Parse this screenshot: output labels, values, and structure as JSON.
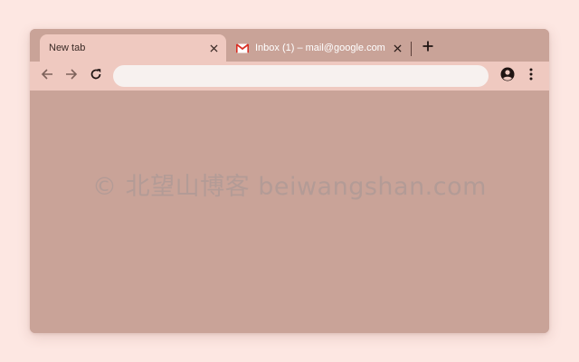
{
  "tabs": [
    {
      "title": "New tab",
      "active": true,
      "close_icon": "close-icon"
    },
    {
      "title": "Inbox (1) – mail@google.com",
      "active": false,
      "favicon": "gmail-icon",
      "close_icon": "close-icon"
    }
  ],
  "new_tab_icon": "plus-icon",
  "toolbar": {
    "back_icon": "arrow-left-icon",
    "forward_icon": "arrow-right-icon",
    "reload_icon": "reload-icon",
    "omnibox_value": "",
    "profile_icon": "account-circle-icon",
    "menu_icon": "more-vert-icon"
  },
  "watermark": "© 北望山博客 beiwangshan.com",
  "colors": {
    "page_background": "#fde7e2",
    "frame": "#c9a398",
    "active_tab_toolbar": "#efc9c0",
    "omnibox": "#f7f1ef"
  }
}
